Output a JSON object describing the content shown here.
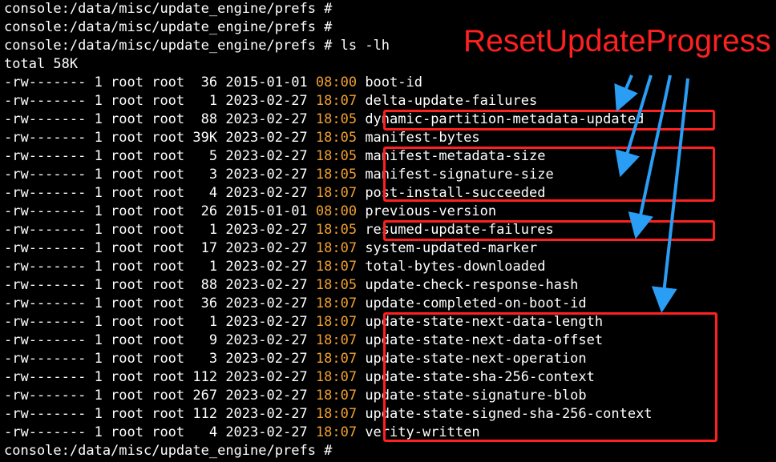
{
  "terminal": {
    "lines": [
      {
        "type": "prompt",
        "text": "console:/data/misc/update_engine/prefs #"
      },
      {
        "type": "prompt",
        "text": "console:/data/misc/update_engine/prefs #"
      },
      {
        "type": "prompt",
        "text": "console:/data/misc/update_engine/prefs # ls -lh"
      },
      {
        "type": "plain",
        "text": "total 58K"
      },
      {
        "type": "entry",
        "perm": "-rw-------",
        "links": "1",
        "owner": "root",
        "group": "root",
        "size": "36",
        "date": "2015-01-01",
        "time": "08:00",
        "name": "boot-id"
      },
      {
        "type": "entry",
        "perm": "-rw-------",
        "links": "1",
        "owner": "root",
        "group": "root",
        "size": "1",
        "date": "2023-02-27",
        "time": "18:07",
        "name": "delta-update-failures"
      },
      {
        "type": "entry",
        "perm": "-rw-------",
        "links": "1",
        "owner": "root",
        "group": "root",
        "size": "88",
        "date": "2023-02-27",
        "time": "18:05",
        "name": "dynamic-partition-metadata-updated"
      },
      {
        "type": "entry",
        "perm": "-rw-------",
        "links": "1",
        "owner": "root",
        "group": "root",
        "size": "39K",
        "date": "2023-02-27",
        "time": "18:05",
        "name": "manifest-bytes"
      },
      {
        "type": "entry",
        "perm": "-rw-------",
        "links": "1",
        "owner": "root",
        "group": "root",
        "size": "5",
        "date": "2023-02-27",
        "time": "18:05",
        "name": "manifest-metadata-size"
      },
      {
        "type": "entry",
        "perm": "-rw-------",
        "links": "1",
        "owner": "root",
        "group": "root",
        "size": "3",
        "date": "2023-02-27",
        "time": "18:05",
        "name": "manifest-signature-size"
      },
      {
        "type": "entry",
        "perm": "-rw-------",
        "links": "1",
        "owner": "root",
        "group": "root",
        "size": "4",
        "date": "2023-02-27",
        "time": "18:07",
        "name": "post-install-succeeded"
      },
      {
        "type": "entry",
        "perm": "-rw-------",
        "links": "1",
        "owner": "root",
        "group": "root",
        "size": "26",
        "date": "2015-01-01",
        "time": "08:00",
        "name": "previous-version"
      },
      {
        "type": "entry",
        "perm": "-rw-------",
        "links": "1",
        "owner": "root",
        "group": "root",
        "size": "1",
        "date": "2023-02-27",
        "time": "18:05",
        "name": "resumed-update-failures"
      },
      {
        "type": "entry",
        "perm": "-rw-------",
        "links": "1",
        "owner": "root",
        "group": "root",
        "size": "17",
        "date": "2023-02-27",
        "time": "18:07",
        "name": "system-updated-marker"
      },
      {
        "type": "entry",
        "perm": "-rw-------",
        "links": "1",
        "owner": "root",
        "group": "root",
        "size": "1",
        "date": "2023-02-27",
        "time": "18:07",
        "name": "total-bytes-downloaded"
      },
      {
        "type": "entry",
        "perm": "-rw-------",
        "links": "1",
        "owner": "root",
        "group": "root",
        "size": "88",
        "date": "2023-02-27",
        "time": "18:05",
        "name": "update-check-response-hash"
      },
      {
        "type": "entry",
        "perm": "-rw-------",
        "links": "1",
        "owner": "root",
        "group": "root",
        "size": "36",
        "date": "2023-02-27",
        "time": "18:07",
        "name": "update-completed-on-boot-id"
      },
      {
        "type": "entry",
        "perm": "-rw-------",
        "links": "1",
        "owner": "root",
        "group": "root",
        "size": "1",
        "date": "2023-02-27",
        "time": "18:07",
        "name": "update-state-next-data-length"
      },
      {
        "type": "entry",
        "perm": "-rw-------",
        "links": "1",
        "owner": "root",
        "group": "root",
        "size": "9",
        "date": "2023-02-27",
        "time": "18:07",
        "name": "update-state-next-data-offset"
      },
      {
        "type": "entry",
        "perm": "-rw-------",
        "links": "1",
        "owner": "root",
        "group": "root",
        "size": "3",
        "date": "2023-02-27",
        "time": "18:07",
        "name": "update-state-next-operation"
      },
      {
        "type": "entry",
        "perm": "-rw-------",
        "links": "1",
        "owner": "root",
        "group": "root",
        "size": "112",
        "date": "2023-02-27",
        "time": "18:07",
        "name": "update-state-sha-256-context"
      },
      {
        "type": "entry",
        "perm": "-rw-------",
        "links": "1",
        "owner": "root",
        "group": "root",
        "size": "267",
        "date": "2023-02-27",
        "time": "18:07",
        "name": "update-state-signature-blob"
      },
      {
        "type": "entry",
        "perm": "-rw-------",
        "links": "1",
        "owner": "root",
        "group": "root",
        "size": "112",
        "date": "2023-02-27",
        "time": "18:07",
        "name": "update-state-signed-sha-256-context"
      },
      {
        "type": "entry",
        "perm": "-rw-------",
        "links": "1",
        "owner": "root",
        "group": "root",
        "size": "4",
        "date": "2023-02-27",
        "time": "18:07",
        "name": "verity-written"
      },
      {
        "type": "prompt",
        "text": "console:/data/misc/update_engine/prefs #"
      }
    ]
  },
  "annotation": {
    "title": "ResetUpdateProgress"
  },
  "colors": {
    "background": "#000000",
    "text": "#ffffff",
    "time_highlight": "#f0a030",
    "annotation_red": "#ff2020",
    "arrow_blue": "#2a9df4"
  }
}
